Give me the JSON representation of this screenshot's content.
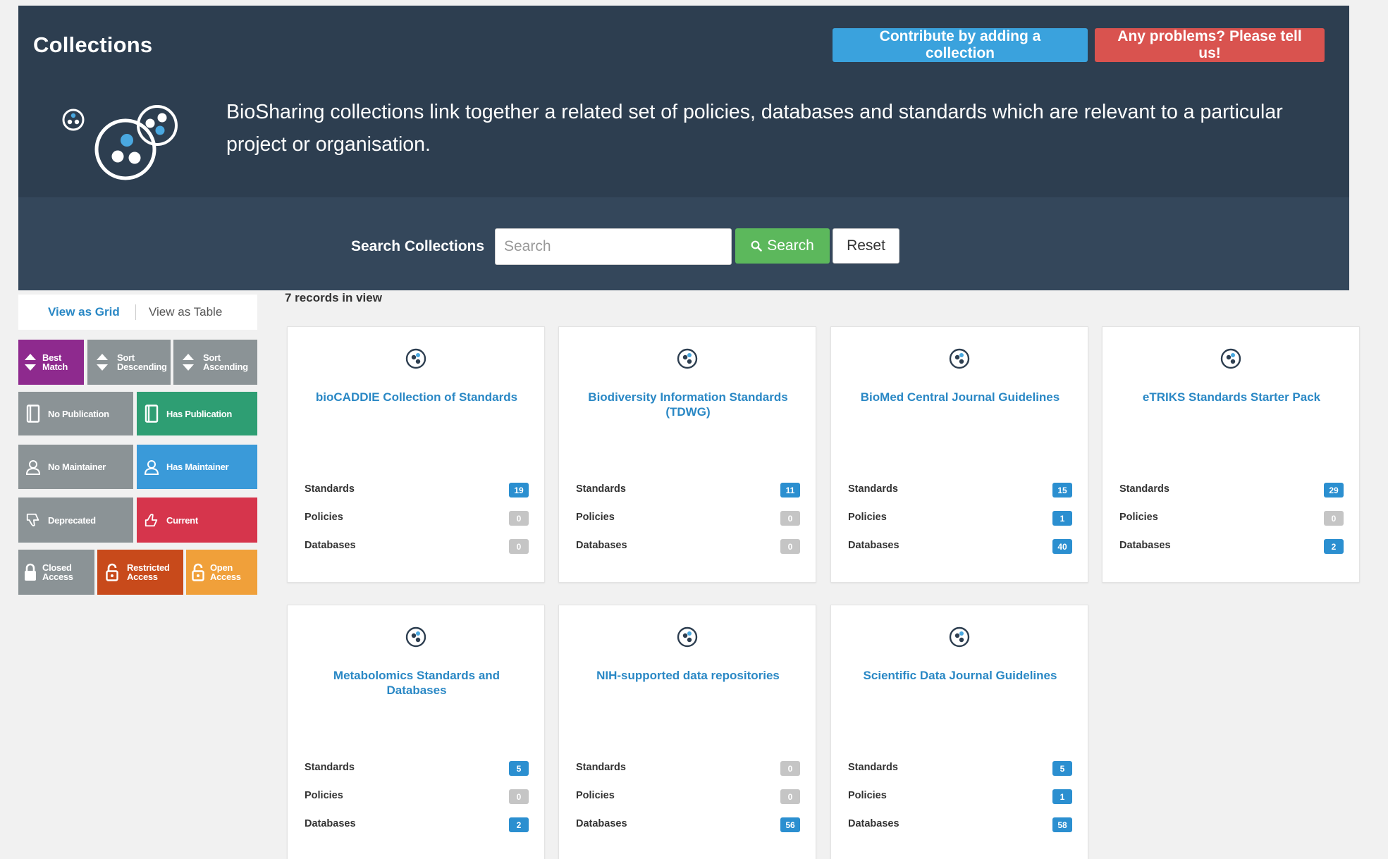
{
  "header": {
    "title": "Collections",
    "contribute_label": "Contribute by adding a collection",
    "problems_label": "Any problems? Please tell us!",
    "intro": "BioSharing collections link together a related set of policies, databases and standards which are relevant to a particular project or organisation."
  },
  "search": {
    "label": "Search Collections",
    "placeholder": "Search",
    "value": "",
    "search_label": "Search",
    "reset_label": "Reset"
  },
  "view": {
    "grid_label": "View as Grid",
    "table_label": "View as Table",
    "active": "grid"
  },
  "filters": [
    {
      "id": "best-match",
      "label": [
        "Best",
        "Match"
      ],
      "color": "#8e2a8e",
      "icon": "sort-arrows-icon"
    },
    {
      "id": "sort-descending",
      "label": [
        "Sort",
        "Descending"
      ],
      "color": "#8b9396",
      "icon": "sort-arrows-icon"
    },
    {
      "id": "sort-ascending",
      "label": [
        "Sort",
        "Ascending"
      ],
      "color": "#8b9396",
      "icon": "sort-arrows-icon"
    },
    {
      "id": "no-publication",
      "label": [
        "No Publication"
      ],
      "color": "#8b9396",
      "icon": "book-icon"
    },
    {
      "id": "has-publication",
      "label": [
        "Has Publication"
      ],
      "color": "#2e9e73",
      "icon": "book-icon"
    },
    {
      "id": "no-maintainer",
      "label": [
        "No Maintainer"
      ],
      "color": "#8b9396",
      "icon": "user-icon"
    },
    {
      "id": "has-maintainer",
      "label": [
        "Has Maintainer"
      ],
      "color": "#3a9ad9",
      "icon": "user-icon"
    },
    {
      "id": "deprecated",
      "label": [
        "Deprecated"
      ],
      "color": "#8b9396",
      "icon": "thumbs-down-icon"
    },
    {
      "id": "current",
      "label": [
        "Current"
      ],
      "color": "#d6354c",
      "icon": "thumbs-up-icon"
    },
    {
      "id": "closed-access",
      "label": [
        "Closed",
        "Access"
      ],
      "color": "#8b9396",
      "icon": "lock-closed-icon"
    },
    {
      "id": "restricted-access",
      "label": [
        "Restricted",
        "Access"
      ],
      "color": "#c84a1b",
      "icon": "lock-open-icon"
    },
    {
      "id": "open-access",
      "label": [
        "Open",
        "Access"
      ],
      "color": "#f0a03a",
      "icon": "lock-open-icon"
    }
  ],
  "records": {
    "count_text": "7 records in view",
    "row_labels": {
      "standards": "Standards",
      "policies": "Policies",
      "databases": "Databases"
    },
    "items": [
      {
        "title": "bioCADDIE Collection of Standards",
        "standards": "19",
        "policies": "0",
        "databases": "0"
      },
      {
        "title": "Biodiversity Information Standards (TDWG)",
        "standards": "11",
        "policies": "0",
        "databases": "0"
      },
      {
        "title": "BioMed Central Journal Guidelines",
        "standards": "15",
        "policies": "1",
        "databases": "40"
      },
      {
        "title": "eTRIKS Standards Starter Pack",
        "standards": "29",
        "policies": "0",
        "databases": "2"
      },
      {
        "title": "Metabolomics Standards and Databases",
        "standards": "5",
        "policies": "0",
        "databases": "2"
      },
      {
        "title": "NIH-supported data repositories",
        "standards": "0",
        "policies": "0",
        "databases": "56"
      },
      {
        "title": "Scientific Data Journal Guidelines",
        "standards": "5",
        "policies": "1",
        "databases": "58"
      }
    ]
  }
}
